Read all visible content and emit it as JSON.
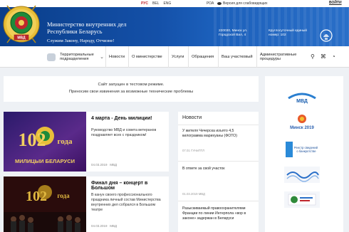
{
  "topbar": {
    "languages": [
      "РУС",
      "BEL",
      "ENG"
    ],
    "rss": "РОА",
    "visually_impaired": "Версия для слабовидящих",
    "login": "ВОЙТИ"
  },
  "header": {
    "title_line1": "Министерство внутренних дел",
    "title_line2": "Республики Беларусь",
    "slogan": "Служим Закону, Народу, Отчизне!",
    "address_line1": "220030, Минск ул.",
    "address_line2": "Городской Вал, 4",
    "duty_line1": "Круглосуточный единый",
    "duty_line2": "номер: 102"
  },
  "nav": {
    "territorial_line1": "Территориальные",
    "territorial_line2": "подразделения",
    "items": [
      "Новости",
      "О министерстве",
      "Услуги",
      "Обращения",
      "Ваш участковый"
    ],
    "admin_line1": "Административные",
    "admin_line2": "процедуры"
  },
  "notice": {
    "line1": "Сайт запущен в тестовом режиме.",
    "line2": "Приносим свои извинения за возможные технические проблемы"
  },
  "cards": [
    {
      "headline": "4 марта - День милиции!",
      "text": "Руководство МВД и совета ветеранов поздравляет всех с праздником!",
      "date": "04.03.2019",
      "tag": "МВД",
      "image_big": "102",
      "image_small": "года",
      "image_caption": "МИЛИЦЫИ БЕЛАРУСИ"
    },
    {
      "headline": "Финал дня – концерт в Большом",
      "text": "В канун своего профессионального праздника личный состав Министерства внутренних дел собрался в Большом театре",
      "date": "04.03.2019",
      "tag": "МВД",
      "image_big": "102",
      "image_small": "года"
    }
  ],
  "news": {
    "heading": "Новости",
    "items": [
      {
        "text": "У жителя Чечерска изъято 4,5 килограмма марихуаны (ФОТО)",
        "date": "07.01 ГУНиПТЛ"
      },
      {
        "text": "В ответе за свой участок",
        "date": "01.03.2019 МВД"
      },
      {
        "text": "Разыскиваемый правоохранителями Франции по линии Интерпола «вор в законе» задержан в Беларуси",
        "date": ""
      }
    ]
  },
  "sidebar": {
    "banners": [
      "МВД",
      "Минск 2019",
      "Реестр сведений о банкротстве",
      "Banner",
      "Banner"
    ]
  },
  "colors": {
    "header_blue": "#1450a8",
    "accent_red": "#c0262d",
    "gold": "#d4a928"
  }
}
